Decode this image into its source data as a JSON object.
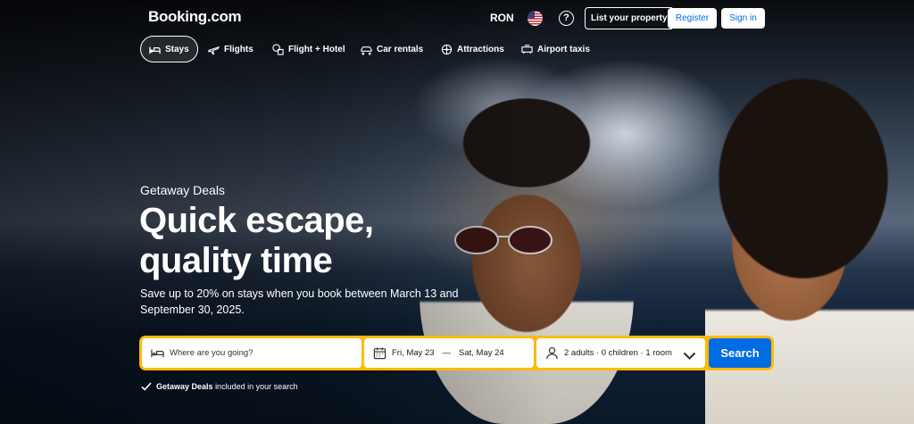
{
  "header": {
    "logo": "Booking.com",
    "currency": "RON",
    "list_property": "List your property",
    "register": "Register",
    "sign_in": "Sign in"
  },
  "nav": {
    "tabs": [
      {
        "label": "Stays",
        "icon": "bed-icon",
        "active": true
      },
      {
        "label": "Flights",
        "icon": "plane-icon"
      },
      {
        "label": "Flight + Hotel",
        "icon": "flight-hotel-icon"
      },
      {
        "label": "Car rentals",
        "icon": "car-icon"
      },
      {
        "label": "Attractions",
        "icon": "attractions-icon"
      },
      {
        "label": "Airport taxis",
        "icon": "taxi-icon"
      }
    ]
  },
  "hero": {
    "kicker": "Getaway Deals",
    "headline": "Quick escape, quality time",
    "subtext": "Save up to 20% on stays when you book between March 13 and September 30, 2025."
  },
  "search": {
    "destination_placeholder": "Where are you going?",
    "date_start": "Fri, May 23",
    "date_sep": "—",
    "date_end": "Sat, May 24",
    "guests": "2 adults · 0 children · 1 room",
    "button": "Search",
    "included_bold": "Getaway Deals",
    "included_rest": "included in your search"
  },
  "colors": {
    "brand_blue": "#006ce4",
    "search_border": "#febb02"
  }
}
